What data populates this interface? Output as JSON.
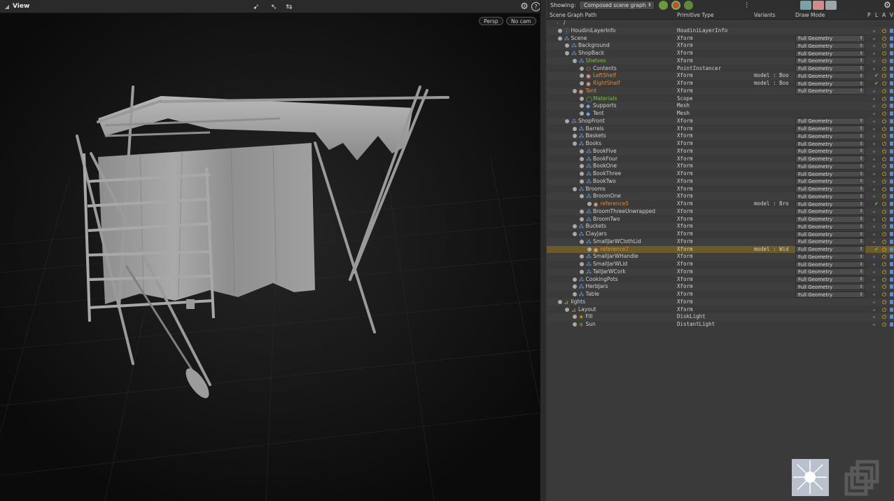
{
  "viewport": {
    "title": "View",
    "camera_menu": "Persp",
    "cam_menu": "No cam"
  },
  "scene_graph": {
    "showing_label": "Showing:",
    "showing_value": "Composed scene graph",
    "columns": {
      "path": "Scene Graph Path",
      "prim_type": "Primitive Type",
      "variants": "Variants",
      "draw_mode": "Draw Mode",
      "p": "P",
      "l": "L",
      "a": "A",
      "v": "V"
    },
    "rows": [
      {
        "name": "/",
        "type": "",
        "variant": "",
        "draw": "",
        "depth": 0,
        "icon": "root-icon",
        "color": "#d0d0d0"
      },
      {
        "name": "HoudiniLayerInfo",
        "type": "HoudiniLayerInfo",
        "variant": "",
        "draw": "",
        "depth": 1,
        "icon": "info-icon",
        "color": "#d0d0d0"
      },
      {
        "name": "Scene",
        "type": "Xform",
        "variant": "",
        "draw": "Full Geometry",
        "depth": 1,
        "icon": "xform-icon",
        "color": "#d0d0d0"
      },
      {
        "name": "Background",
        "type": "Xform",
        "variant": "",
        "draw": "Full Geometry",
        "depth": 2,
        "icon": "xform-icon",
        "color": "#d0d0d0"
      },
      {
        "name": "ShopBack",
        "type": "Xform",
        "variant": "",
        "draw": "Full Geometry",
        "depth": 2,
        "icon": "xform-icon",
        "color": "#d0d0d0"
      },
      {
        "name": "Shelves",
        "type": "Xform",
        "variant": "",
        "draw": "Full Geometry",
        "depth": 3,
        "icon": "xform-icon",
        "color": "#7fbf4a"
      },
      {
        "name": "Contents",
        "type": "PointInstancer",
        "variant": "",
        "draw": "Full Geometry",
        "depth": 4,
        "icon": "instancer-icon",
        "color": "#d0d0d0"
      },
      {
        "name": "LeftShelf",
        "type": "Xform",
        "variant": "model : Boo",
        "draw": "Full Geometry",
        "depth": 4,
        "icon": "reference-icon",
        "color": "#e08a3a"
      },
      {
        "name": "RightShelf",
        "type": "Xform",
        "variant": "model : Boo",
        "draw": "Full Geometry",
        "depth": 4,
        "icon": "reference-icon",
        "color": "#e08a3a"
      },
      {
        "name": "Tent",
        "type": "Xform",
        "variant": "",
        "draw": "Full Geometry",
        "depth": 3,
        "icon": "reference-icon",
        "color": "#e08a3a"
      },
      {
        "name": "Materials",
        "type": "Scope",
        "variant": "",
        "draw": "",
        "depth": 4,
        "icon": "scope-icon",
        "color": "#7fbf4a"
      },
      {
        "name": "Supports",
        "type": "Mesh",
        "variant": "",
        "draw": "",
        "depth": 4,
        "icon": "mesh-icon",
        "color": "#d0d0d0"
      },
      {
        "name": "Tent",
        "type": "Mesh",
        "variant": "",
        "draw": "",
        "depth": 4,
        "icon": "mesh-icon",
        "color": "#d0d0d0"
      },
      {
        "name": "ShopFront",
        "type": "Xform",
        "variant": "",
        "draw": "Full Geometry",
        "depth": 2,
        "icon": "xform-icon",
        "color": "#d0d0d0"
      },
      {
        "name": "Barrels",
        "type": "Xform",
        "variant": "",
        "draw": "Full Geometry",
        "depth": 3,
        "icon": "xform-icon",
        "color": "#d0d0d0"
      },
      {
        "name": "Baskets",
        "type": "Xform",
        "variant": "",
        "draw": "Full Geometry",
        "depth": 3,
        "icon": "xform-icon",
        "color": "#d0d0d0"
      },
      {
        "name": "Books",
        "type": "Xform",
        "variant": "",
        "draw": "Full Geometry",
        "depth": 3,
        "icon": "xform-icon",
        "color": "#d0d0d0"
      },
      {
        "name": "BookFive",
        "type": "Xform",
        "variant": "",
        "draw": "Full Geometry",
        "depth": 4,
        "icon": "xform-icon",
        "color": "#d0d0d0"
      },
      {
        "name": "BookFour",
        "type": "Xform",
        "variant": "",
        "draw": "Full Geometry",
        "depth": 4,
        "icon": "xform-icon",
        "color": "#d0d0d0"
      },
      {
        "name": "BookOne",
        "type": "Xform",
        "variant": "",
        "draw": "Full Geometry",
        "depth": 4,
        "icon": "xform-icon",
        "color": "#d0d0d0"
      },
      {
        "name": "BookThree",
        "type": "Xform",
        "variant": "",
        "draw": "Full Geometry",
        "depth": 4,
        "icon": "xform-icon",
        "color": "#d0d0d0"
      },
      {
        "name": "BookTwo",
        "type": "Xform",
        "variant": "",
        "draw": "Full Geometry",
        "depth": 4,
        "icon": "xform-icon",
        "color": "#d0d0d0"
      },
      {
        "name": "Brooms",
        "type": "Xform",
        "variant": "",
        "draw": "Full Geometry",
        "depth": 3,
        "icon": "xform-icon",
        "color": "#d0d0d0"
      },
      {
        "name": "BroomOne",
        "type": "Xform",
        "variant": "",
        "draw": "Full Geometry",
        "depth": 4,
        "icon": "xform-icon",
        "color": "#d0d0d0"
      },
      {
        "name": "reference5",
        "type": "Xform",
        "variant": "model : Bro",
        "draw": "Full Geometry",
        "depth": 5,
        "icon": "reference-icon",
        "color": "#e08a3a"
      },
      {
        "name": "BroomThreeUnwrapped",
        "type": "Xform",
        "variant": "",
        "draw": "Full Geometry",
        "depth": 4,
        "icon": "xform-icon",
        "color": "#d0d0d0"
      },
      {
        "name": "BroomTwo",
        "type": "Xform",
        "variant": "",
        "draw": "Full Geometry",
        "depth": 4,
        "icon": "xform-icon",
        "color": "#d0d0d0"
      },
      {
        "name": "Buckets",
        "type": "Xform",
        "variant": "",
        "draw": "Full Geometry",
        "depth": 3,
        "icon": "xform-icon",
        "color": "#d0d0d0"
      },
      {
        "name": "ClayJars",
        "type": "Xform",
        "variant": "",
        "draw": "Full Geometry",
        "depth": 3,
        "icon": "xform-icon",
        "color": "#d0d0d0"
      },
      {
        "name": "SmallJarWClothLid",
        "type": "Xform",
        "variant": "",
        "draw": "Full Geometry",
        "depth": 4,
        "icon": "xform-icon",
        "color": "#d0d0d0"
      },
      {
        "name": "reference7",
        "type": "Xform",
        "variant": "model : Wid",
        "draw": "Full Geometry",
        "depth": 5,
        "icon": "reference-icon",
        "color": "#e08a3a",
        "selected": true
      },
      {
        "name": "SmallJarWHandle",
        "type": "Xform",
        "variant": "",
        "draw": "Full Geometry",
        "depth": 4,
        "icon": "xform-icon",
        "color": "#d0d0d0"
      },
      {
        "name": "SmallJarWLid",
        "type": "Xform",
        "variant": "",
        "draw": "Full Geometry",
        "depth": 4,
        "icon": "xform-icon",
        "color": "#d0d0d0"
      },
      {
        "name": "TallJarWCork",
        "type": "Xform",
        "variant": "",
        "draw": "Full Geometry",
        "depth": 4,
        "icon": "xform-icon",
        "color": "#d0d0d0"
      },
      {
        "name": "CookingPots",
        "type": "Xform",
        "variant": "",
        "draw": "Full Geometry",
        "depth": 3,
        "icon": "xform-icon",
        "color": "#d0d0d0"
      },
      {
        "name": "HerbJars",
        "type": "Xform",
        "variant": "",
        "draw": "Full Geometry",
        "depth": 3,
        "icon": "xform-icon",
        "color": "#d0d0d0"
      },
      {
        "name": "Table",
        "type": "Xform",
        "variant": "",
        "draw": "Full Geometry",
        "depth": 3,
        "icon": "xform-icon",
        "color": "#d0d0d0"
      },
      {
        "name": "lights",
        "type": "Xform",
        "variant": "",
        "draw": "",
        "depth": 1,
        "icon": "light-group-icon",
        "color": "#d0d0d0"
      },
      {
        "name": "Layout",
        "type": "Xform",
        "variant": "",
        "draw": "",
        "depth": 2,
        "icon": "light-group-icon",
        "color": "#d0d0d0"
      },
      {
        "name": "Fill",
        "type": "DiskLight",
        "variant": "",
        "draw": "",
        "depth": 3,
        "icon": "disk-light-icon",
        "color": "#d0d0d0"
      },
      {
        "name": "Sun",
        "type": "DistantLight",
        "variant": "",
        "draw": "",
        "depth": 3,
        "icon": "distant-light-icon",
        "color": "#d0d0d0"
      }
    ]
  }
}
